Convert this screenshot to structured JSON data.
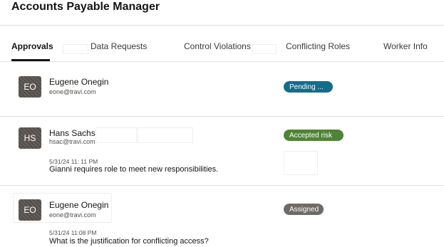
{
  "header": {
    "title": "Accounts Payable Manager"
  },
  "tabs": [
    {
      "label": "Approvals",
      "active": true
    },
    {
      "label": "Data Requests",
      "active": false
    },
    {
      "label": "Control Violations",
      "active": false
    },
    {
      "label": "Conflicting Roles",
      "active": false
    },
    {
      "label": "Worker Info",
      "active": false
    }
  ],
  "rows": [
    {
      "initials": "EO",
      "name": "Eugene Onegin",
      "email": "eone@travi.com",
      "status": "Pending ...",
      "status_color": "#146c8c"
    },
    {
      "initials": "HS",
      "name": "Hans Sachs",
      "email": "hsac@travi.com",
      "timestamp": "5/31/24 11: 11 PM",
      "comment": "Gianni requires role to meet new responsibilities.",
      "status": "Accepted risk",
      "status_color": "#508337"
    },
    {
      "initials": "EO",
      "name": "Eugene Onegin",
      "email": "eone@travi.com",
      "timestamp": "5/31/24 11:08 PM",
      "comment": "What is the justification for conflicting access?",
      "status": "Assigned",
      "status_color": "#6f6a65"
    }
  ]
}
